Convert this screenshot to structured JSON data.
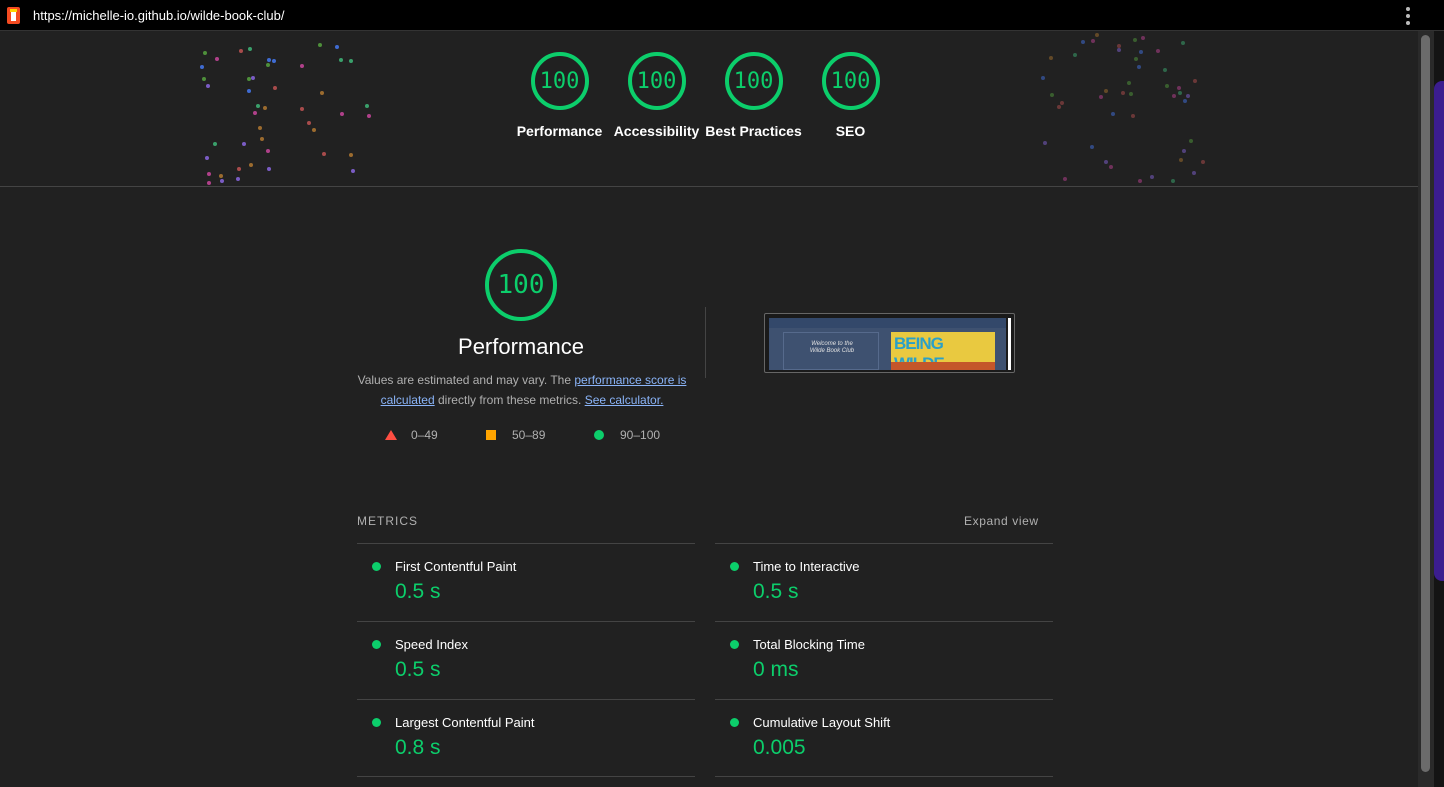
{
  "browser": {
    "url": "https://michelle-io.github.io/wilde-book-club/"
  },
  "header_scores": [
    {
      "score": "100",
      "label": "Performance"
    },
    {
      "score": "100",
      "label": "Accessibility"
    },
    {
      "score": "100",
      "label": "Best Practices"
    },
    {
      "score": "100",
      "label": "SEO"
    }
  ],
  "performance": {
    "score": "100",
    "title": "Performance",
    "desc_prefix": "Values are estimated and may vary. The ",
    "link_score": "performance score is calculated",
    "desc_middle": " directly from these metrics. ",
    "link_calc": "See calculator.",
    "legend": [
      {
        "range": "0–49",
        "color": "#ff4e42",
        "icon": "triangle-icon"
      },
      {
        "range": "50–89",
        "color": "#ffa400",
        "icon": "square-icon"
      },
      {
        "range": "90–100",
        "color": "#0cce6b",
        "icon": "circle-icon"
      }
    ]
  },
  "thumbnail": {
    "site_text": "Welcome to the Wilde Book Club",
    "cover_text": "BEING WILDE"
  },
  "metrics": {
    "heading": "METRICS",
    "expand": "Expand view",
    "left": [
      {
        "label": "First Contentful Paint",
        "value": "0.5 s"
      },
      {
        "label": "Speed Index",
        "value": "0.5 s"
      },
      {
        "label": "Largest Contentful Paint",
        "value": "0.8 s"
      }
    ],
    "right": [
      {
        "label": "Time to Interactive",
        "value": "0.5 s"
      },
      {
        "label": "Total Blocking Time",
        "value": "0 ms"
      },
      {
        "label": "Cumulative Layout Shift",
        "value": "0.005"
      }
    ]
  },
  "colors": {
    "pass": "#0cce6b",
    "average": "#ffa400",
    "fail": "#ff4e42",
    "link": "#8ab4f8",
    "background": "#212121"
  }
}
